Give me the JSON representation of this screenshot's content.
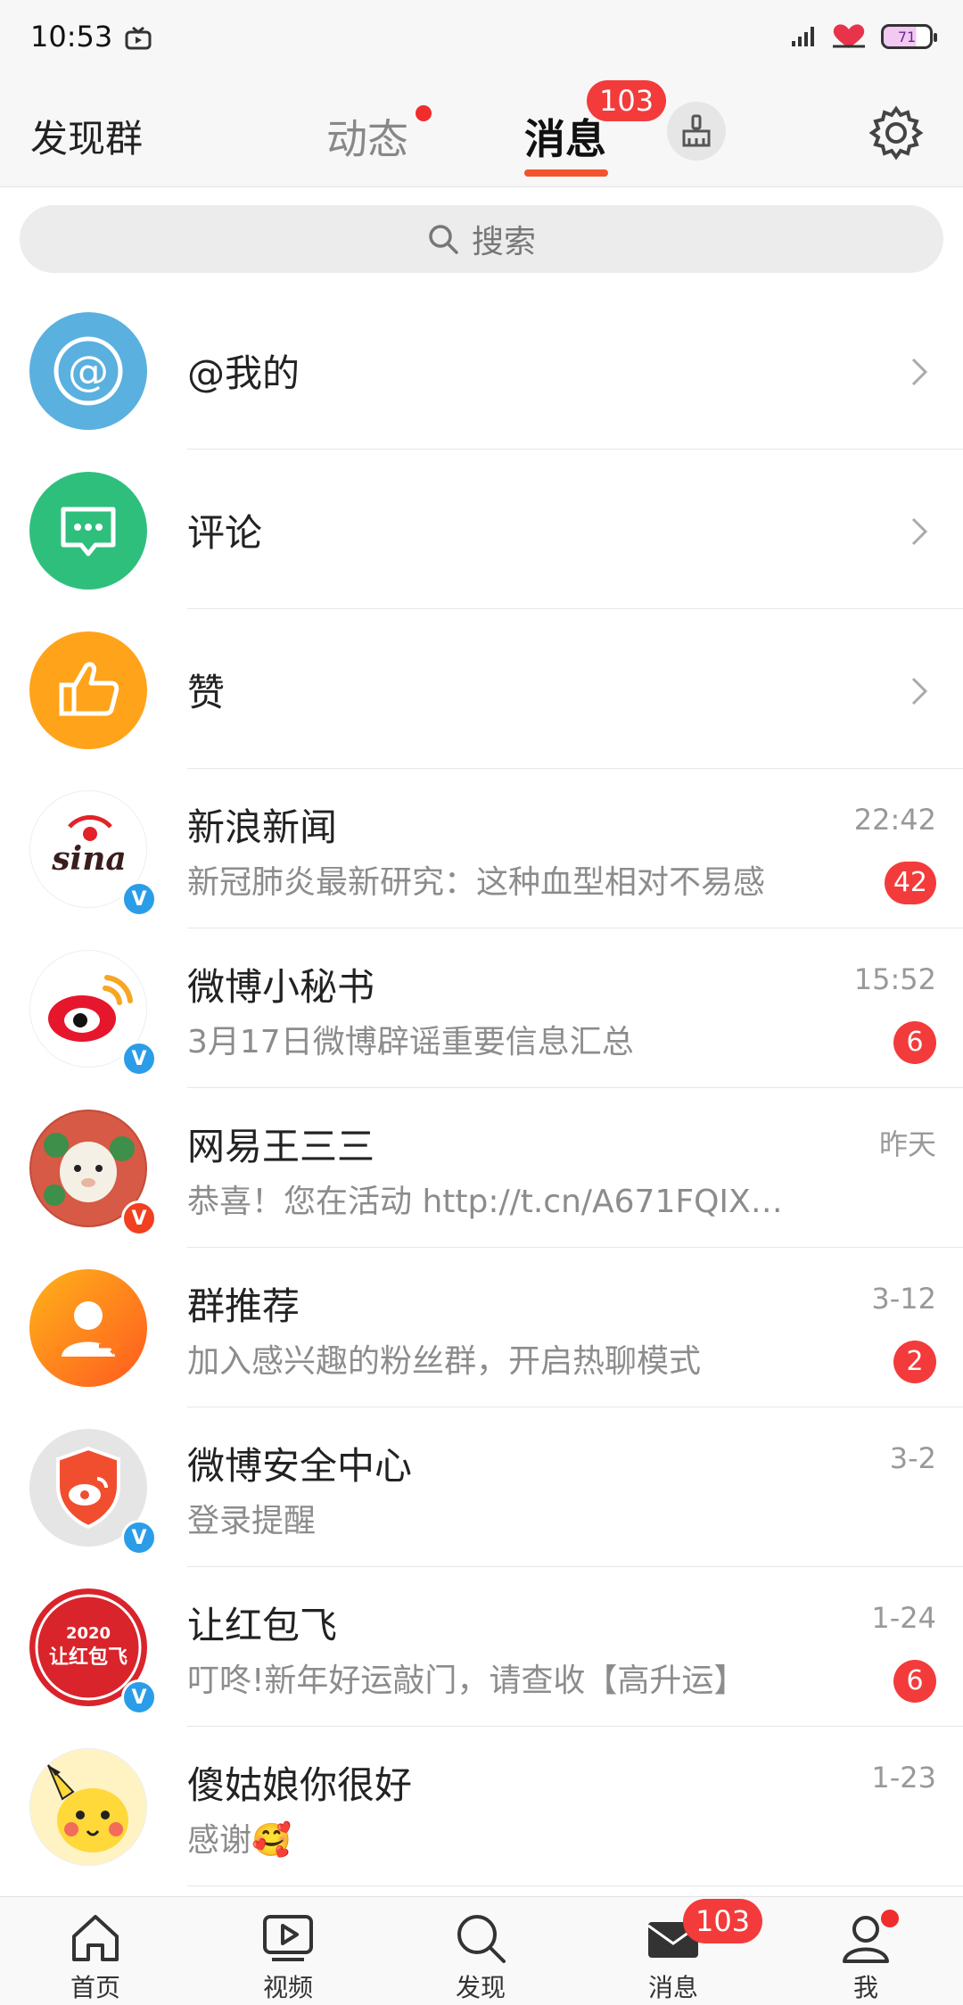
{
  "status_bar": {
    "time": "10:53",
    "battery": "71"
  },
  "header": {
    "left_label": "发现群",
    "tabs": [
      {
        "label": "动态"
      },
      {
        "label": "消息"
      }
    ],
    "message_badge": "103"
  },
  "search": {
    "placeholder": "搜索"
  },
  "shortcuts": [
    {
      "label": "@我的",
      "color": "#5ab0de"
    },
    {
      "label": "评论",
      "color": "#2fbf7d"
    },
    {
      "label": "赞",
      "color": "#ffa31a"
    }
  ],
  "conversations": [
    {
      "name": "新浪新闻",
      "preview": "新冠肺炎最新研究：这种血型相对不易感",
      "time": "22:42",
      "badge": "42",
      "avatar_text": "sina"
    },
    {
      "name": "微博小秘书",
      "preview": "3月17日微博辟谣重要信息汇总",
      "time": "15:52",
      "badge": "6"
    },
    {
      "name": "网易王三三",
      "preview": "恭喜！您在活动 http://t.cn/A671FQIX…",
      "time": "昨天",
      "badge": ""
    },
    {
      "name": "群推荐",
      "preview": "加入感兴趣的粉丝群，开启热聊模式",
      "time": "3-12",
      "badge": "2"
    },
    {
      "name": "微博安全中心",
      "preview": "登录提醒",
      "time": "3-2",
      "badge": ""
    },
    {
      "name": "让红包飞",
      "preview": "叮咚!新年好运敲门，请查收【高升运】",
      "time": "1-24",
      "badge": "6",
      "avatar_text": "让红包飞",
      "avatar_year": "2020"
    },
    {
      "name": "傻姑娘你很好",
      "preview": "感谢🥰",
      "time": "1-23",
      "badge": ""
    }
  ],
  "bottom_nav": {
    "items": [
      {
        "label": "首页"
      },
      {
        "label": "视频"
      },
      {
        "label": "发现"
      },
      {
        "label": "消息"
      },
      {
        "label": "我"
      }
    ],
    "message_badge": "103"
  },
  "colors": {
    "accent": "#f2542d",
    "badge": "#f33b3b",
    "verified": "#2b9de8"
  }
}
